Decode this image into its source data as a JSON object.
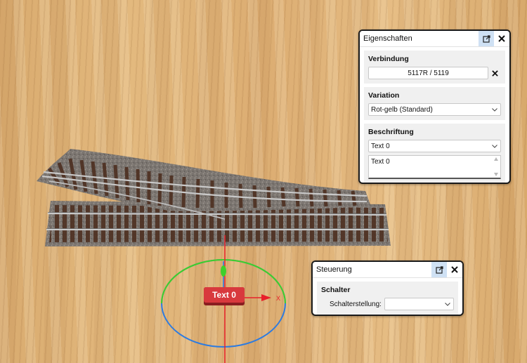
{
  "properties_panel": {
    "title": "Eigenschaften",
    "connection": {
      "heading": "Verbindung",
      "value": "5117R / 5119"
    },
    "variation": {
      "heading": "Variation",
      "selected": "Rot-gelb (Standard)"
    },
    "labeling": {
      "heading": "Beschriftung",
      "selected": "Text 0",
      "text": "Text 0"
    }
  },
  "control_panel": {
    "title": "Steuerung",
    "switch_section": {
      "heading": "Schalter",
      "position_label": "Schalterstellung:",
      "position_value": ""
    }
  },
  "scene": {
    "label_text": "Text 0",
    "axis_x_label": "X",
    "colors": {
      "x_axis": "#e8202a",
      "ring_green": "#3ecf2a",
      "ring_blue": "#2d7be0",
      "label_bg": "#d8393d"
    }
  },
  "icons": [
    "popout-icon",
    "close-icon",
    "clear-icon",
    "chevron-down-icon",
    "scroll-up-icon",
    "scroll-down-icon"
  ]
}
